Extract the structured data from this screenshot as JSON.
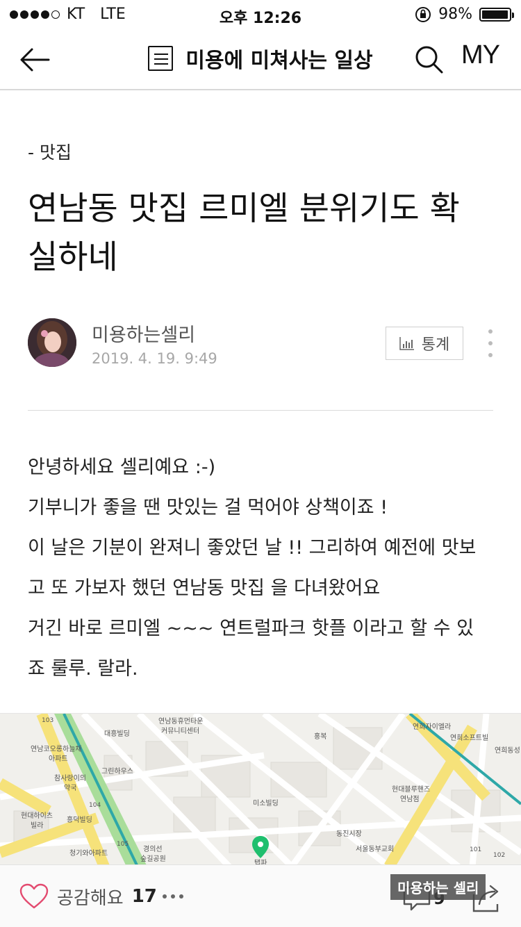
{
  "status_bar": {
    "carrier": "KT",
    "network": "LTE",
    "time": "오후 12:26",
    "battery": "98%",
    "battery_level": 0.98
  },
  "nav": {
    "title": "미용에 미쳐사는 일상",
    "my_label": "MY"
  },
  "post": {
    "category": "- 맛집",
    "title_line1": "연남동 맛집 르미엘 분위기도 확",
    "title_line2": "실하네",
    "author": "미용하는셀리",
    "date": "2019. 4. 19. 9:49",
    "stats_label": "통계",
    "body": [
      "안녕하세요 셀리예요 :-)",
      "기부니가 좋을 땐 맛있는 걸 먹어야 상책이죠 !",
      "이 날은 기분이 완져니 좋았던 날 !! 그리하여 예전에 맛보",
      "고 또 가보자 했던 연남동 맛집 을 다녀왔어요",
      "거긴 바로 르미엘 ~~~ 연트럴파크 핫플 이라고 할 수 있",
      "죠 룰루. 랄라."
    ]
  },
  "map": {
    "labels": {
      "l1": "연남동휴먼타운",
      "l2": "커뮤니티센터",
      "l3": "대흥빌딩",
      "l4": "연남코오롱하늘채",
      "l5": "아파트",
      "l6": "그린하우스",
      "l7": "참사랑이의",
      "l8": "약국",
      "l9": "현대하이츠",
      "l10": "빌라",
      "l11": "흥덕빌딩",
      "l12": "청기와아파트",
      "l13": "경의선",
      "l14": "숲길공원",
      "l15": "홍복",
      "l16": "연희자이엘라",
      "l17": "연희소프트빌",
      "l18": "연희동성",
      "l19": "현대블루핸즈",
      "l20": "연남점",
      "l21": "미소빌딩",
      "l22": "동진시장",
      "l23": "서울동부교회",
      "l24": "탭파",
      "l25": "103",
      "l26": "104",
      "l27": "105",
      "l28": "101",
      "l29": "102"
    },
    "accent": "#1fbf6e"
  },
  "bottom_bar": {
    "like_label": "공감해요",
    "like_count": "17",
    "comment_count": "9",
    "watermark": "미용하는 셀리"
  },
  "colors": {
    "like_heart": "#e34a6f",
    "map_road_yellow": "#f6e27a",
    "map_park_green": "#a9dd9a",
    "map_rail_teal": "#2ea8a8"
  }
}
